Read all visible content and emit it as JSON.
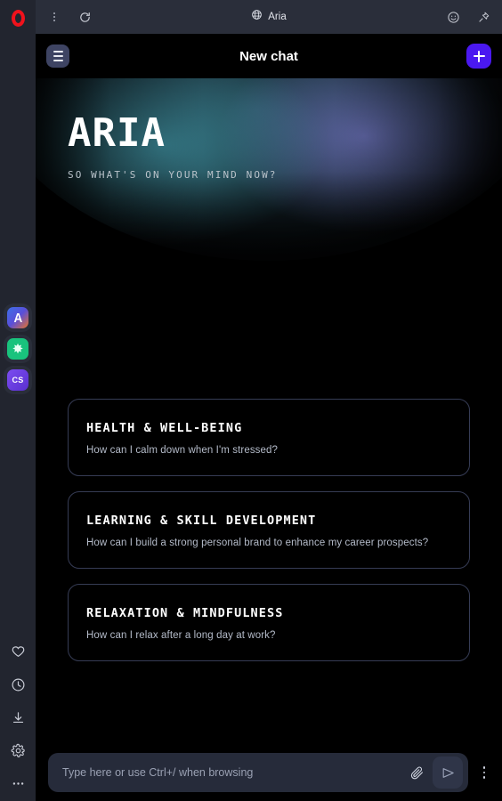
{
  "browser": {
    "logo": "opera-logo",
    "toolbar": {
      "menu_icon": "vertical-dots-icon",
      "reload_icon": "reload-icon",
      "page_icon": "globe-icon",
      "page_title": "Aria",
      "emoji_icon": "smiley-icon",
      "pin_icon": "pin-icon"
    },
    "sidebar": {
      "apps": [
        {
          "name": "aria",
          "glyph": "A",
          "color": "#3d6fe8"
        },
        {
          "name": "chatgpt",
          "glyph": "✸",
          "color": "#19c37d"
        },
        {
          "name": "cs",
          "glyph": "CS",
          "color": "#7b4df0"
        }
      ],
      "tools": [
        {
          "name": "favorites",
          "icon": "heart-icon"
        },
        {
          "name": "history",
          "icon": "clock-icon"
        },
        {
          "name": "downloads",
          "icon": "download-icon"
        },
        {
          "name": "settings",
          "icon": "gear-icon"
        },
        {
          "name": "more",
          "icon": "horizontal-dots-icon"
        }
      ]
    }
  },
  "aria": {
    "header": {
      "menu_icon": "hamburger-icon",
      "title": "New chat",
      "new_chat_icon": "plus-icon"
    },
    "hero": {
      "title": "ARIA",
      "subtitle": "SO WHAT'S ON YOUR MIND NOW?",
      "gradient_teal": "#38808e",
      "gradient_purple": "#686cb2"
    },
    "suggestions": [
      {
        "title": "HEALTH & WELL-BEING",
        "prompt": "How can I calm down when I'm stressed?"
      },
      {
        "title": "LEARNING & SKILL DEVELOPMENT",
        "prompt": "How can I build a strong personal brand to enhance my career prospects?"
      },
      {
        "title": "RELAXATION & MINDFULNESS",
        "prompt": "How can I relax after a long day at work?"
      }
    ],
    "composer": {
      "placeholder": "Type here or use Ctrl+/ when browsing",
      "value": "",
      "attach_icon": "paperclip-icon",
      "send_icon": "send-icon",
      "more_icon": "vertical-dots-icon",
      "accent_color": "#4a18f0"
    }
  }
}
